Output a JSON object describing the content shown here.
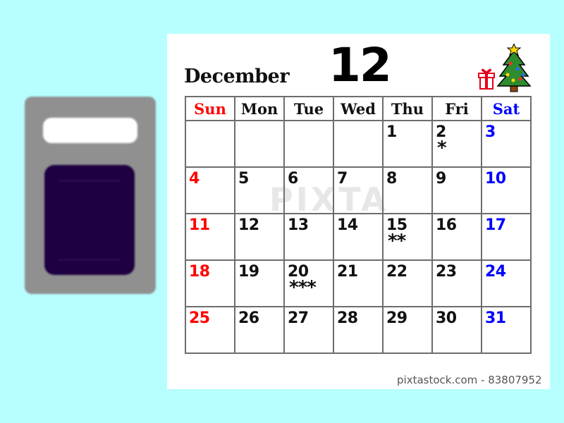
{
  "calendar": {
    "month_name": "December",
    "month_number": "12",
    "weekdays": [
      "Sun",
      "Mon",
      "Tue",
      "Wed",
      "Thu",
      "Fri",
      "Sat"
    ],
    "weeks": [
      [
        "",
        "",
        "",
        "",
        "1",
        "2",
        "3"
      ],
      [
        "4",
        "5",
        "6",
        "7",
        "8",
        "9",
        "10"
      ],
      [
        "11",
        "12",
        "13",
        "14",
        "15",
        "16",
        "17"
      ],
      [
        "18",
        "19",
        "20",
        "21",
        "22",
        "23",
        "24"
      ],
      [
        "25",
        "26",
        "27",
        "28",
        "29",
        "30",
        "31"
      ]
    ],
    "marks": {
      "2": "*",
      "15": "**",
      "20": "***"
    },
    "colors": {
      "sunday": "#ff0000",
      "saturday": "#0000ff",
      "weekday": "#111111",
      "grid": "#6d6d6d"
    }
  },
  "decorations": [
    "gift-icon",
    "christmas-tree-icon"
  ],
  "watermark": "PIXTA",
  "caption": "pixtastock.com - 83807952",
  "background_color": "#b7ffff"
}
